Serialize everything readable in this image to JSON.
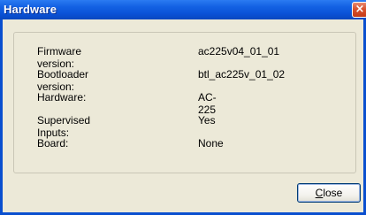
{
  "window": {
    "title": "Hardware",
    "close_icon": "close-icon"
  },
  "info": {
    "rows": [
      {
        "label": "Firmware version:",
        "value": "ac225v04_01_01"
      },
      {
        "label": "Bootloader version:",
        "value": "btl_ac225v_01_02"
      },
      {
        "label": "Hardware:",
        "value": "AC-225"
      },
      {
        "label": "Supervised Inputs:",
        "value": "Yes"
      },
      {
        "label": "Board:",
        "value": "None"
      }
    ]
  },
  "buttons": {
    "close_mnemonic": "C",
    "close_rest": "lose"
  },
  "colors": {
    "titlebar": "#0a52d7",
    "client_background": "#ece9d8",
    "close_button_red": "#d8522e"
  }
}
